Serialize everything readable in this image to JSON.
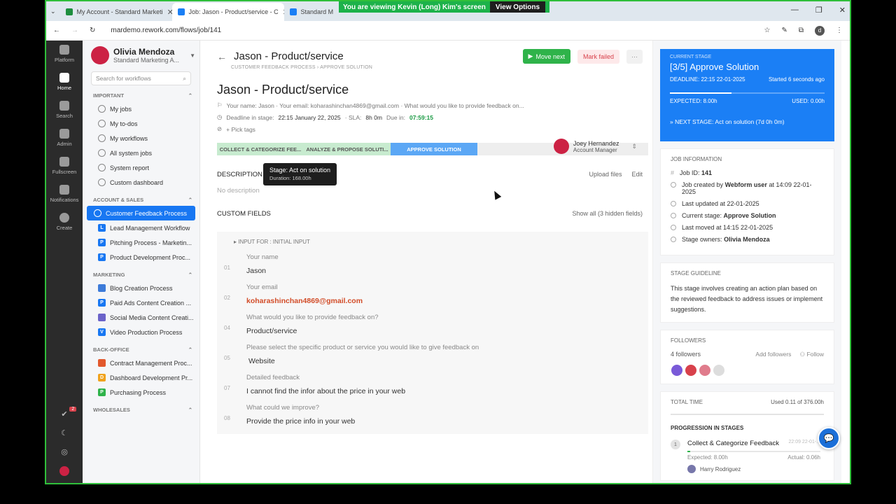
{
  "browser": {
    "tabs": [
      {
        "title": "My Account - Standard Marketi",
        "color": "#1e8e3e"
      },
      {
        "title": "Job: Jason - Product/service - C",
        "color": "#1b7ff5"
      },
      {
        "title": "Standard M",
        "color": "#1b7ff5"
      }
    ],
    "share_banner": "You are viewing  Kevin (Long) Kim's screen",
    "view_options": "View Options",
    "url": "mardemo.rework.com/flows/job/141",
    "profile_letter": "d"
  },
  "rail": {
    "items": [
      "Platform",
      "Home",
      "Search",
      "Admin",
      "Fullscreen",
      "Notifications",
      "Create"
    ],
    "badge": "2"
  },
  "sidebar": {
    "user_name": "Olivia Mendoza",
    "user_org": "Standard Marketing A...",
    "search_placeholder": "Search for workflows",
    "important_label": "IMPORTANT",
    "important": [
      "My jobs",
      "My to-dos",
      "My workflows",
      "All system jobs",
      "System report",
      "Custom dashboard"
    ],
    "acct_label": "ACCOUNT & SALES",
    "acct": [
      {
        "label": "Customer Feedback Process",
        "ic": "",
        "color": "#1b7ff5"
      },
      {
        "label": "Lead Management Workflow",
        "ic": "L",
        "color": "#1877f2"
      },
      {
        "label": "Pitching Process - Marketin...",
        "ic": "P",
        "color": "#1877f2"
      },
      {
        "label": "Product Development Proc...",
        "ic": "P",
        "color": "#1877f2"
      }
    ],
    "mkt_label": "MARKETING",
    "mkt": [
      {
        "label": "Blog Creation Process",
        "ic": "",
        "color": "#3d7bd9"
      },
      {
        "label": "Paid Ads Content Creation ...",
        "ic": "P",
        "color": "#1877f2"
      },
      {
        "label": "Social Media Content Creati...",
        "ic": "",
        "color": "#6b63c9"
      },
      {
        "label": "Video Production Process",
        "ic": "V",
        "color": "#1877f2"
      }
    ],
    "bo_label": "BACK-OFFICE",
    "bo": [
      {
        "label": "Contract Management Proc...",
        "ic": "",
        "color": "#e2582c"
      },
      {
        "label": "Dashboard Development Pr...",
        "ic": "D",
        "color": "#f0a21c"
      },
      {
        "label": "Purchasing Process",
        "ic": "P",
        "color": "#2fb34a"
      }
    ],
    "ws_label": "WHOLESALES"
  },
  "main": {
    "title": "Jason - Product/service",
    "move_next": "Move next",
    "mark_failed": "Mark failed",
    "more": "···",
    "crumb1": "CUSTOMER FEEDBACK PROCESS",
    "crumb2": "APPROVE SOLUTION",
    "heading": "Jason - Product/service",
    "summary": "Your name: Jason · Your email: koharashinchan4869@gmail.com · What would you like to provide feedback on...",
    "deadline_label": "Deadline in stage:",
    "deadline": "22:15 January 22, 2025",
    "sla_label": "· SLA:",
    "sla": "8h 0m",
    "due_label": "Due in:",
    "due": "07:59:15",
    "pick_tags": "+ Pick tags",
    "assignee_name": "Joey Hernandez",
    "assignee_role": "Account Manager",
    "stages": [
      "COLLECT & CATEGORIZE FEE...",
      "ANALYZE & PROPOSE SOLUTI...",
      "APPROVE SOLUTION",
      "",
      ""
    ],
    "tooltip_title": "Stage: Act on solution",
    "tooltip_dur": "Duration: 168.00h",
    "description_label": "DESCRIPTION",
    "upload": "Upload files",
    "edit": "Edit",
    "no_description": "No description",
    "custom_fields_label": "CUSTOM FIELDS",
    "show_all": "Show all (3 hidden fields)",
    "input_for": "INPUT FOR : INITIAL INPUT",
    "fields": [
      {
        "num": "01",
        "label": "Your name",
        "value": "Jason"
      },
      {
        "num": "02",
        "label": "Your email",
        "value": "koharashinchan4869@gmail.com"
      },
      {
        "num": "04",
        "label": "What would you like to provide feedback on?",
        "value": "Product/service"
      },
      {
        "num": "05",
        "label": "Please select the specific product or service you would like to give feedback on",
        "value": "Website"
      },
      {
        "num": "07",
        "label": "Detailed feedback",
        "value": "I cannot find the infor about the price in your web"
      },
      {
        "num": "08",
        "label": "What could we improve?",
        "value": "Provide the price info in your web"
      }
    ]
  },
  "right": {
    "current_stage_label": "CURRENT STAGE",
    "current_stage": "[3/5] Approve Solution",
    "deadline": "DEADLINE: 22:15 22-01-2025",
    "started": "Started 6 seconds ago",
    "expected": "EXPECTED: 8.00h",
    "used": "USED: 0.00h",
    "next_stage_label": "» NEXT STAGE:",
    "next_stage": "Act on solution (7d 0h 0m)",
    "job_info_label": "JOB INFORMATION",
    "job_id_label": "Job ID:",
    "job_id": "141",
    "created_pre": "Job created by",
    "created_by": "Webform user",
    "created_at": "at 14:09 22-01-2025",
    "last_updated": "Last updated at 22-01-2025",
    "current_stage_row_label": "Current stage:",
    "current_stage_row": "Approve Solution",
    "last_moved": "Last moved at 14:15 22-01-2025",
    "owners_label": "Stage owners:",
    "owners": "Olivia Mendoza",
    "guideline_label": "STAGE GUIDELINE",
    "guideline": "This stage involves creating an action plan based on the reviewed feedback to address issues or implement suggestions.",
    "followers_label": "FOLLOWERS",
    "followers_count": "4 followers",
    "add_followers": "Add followers",
    "follow": "Follow",
    "total_time_label": "TOTAL TIME",
    "total_used": "Used 0.11 of 376.00h",
    "progression_label": "PROGRESSION IN STAGES",
    "stage1_num": "1",
    "stage1_name": "Collect & Categorize Feedback",
    "stage1_date": "22:09 22-01-...",
    "stage1_expected": "Expected: 8.00h",
    "stage1_actual": "Actual: 0.06h",
    "stage1_owner": "Harry Rodriguez"
  }
}
